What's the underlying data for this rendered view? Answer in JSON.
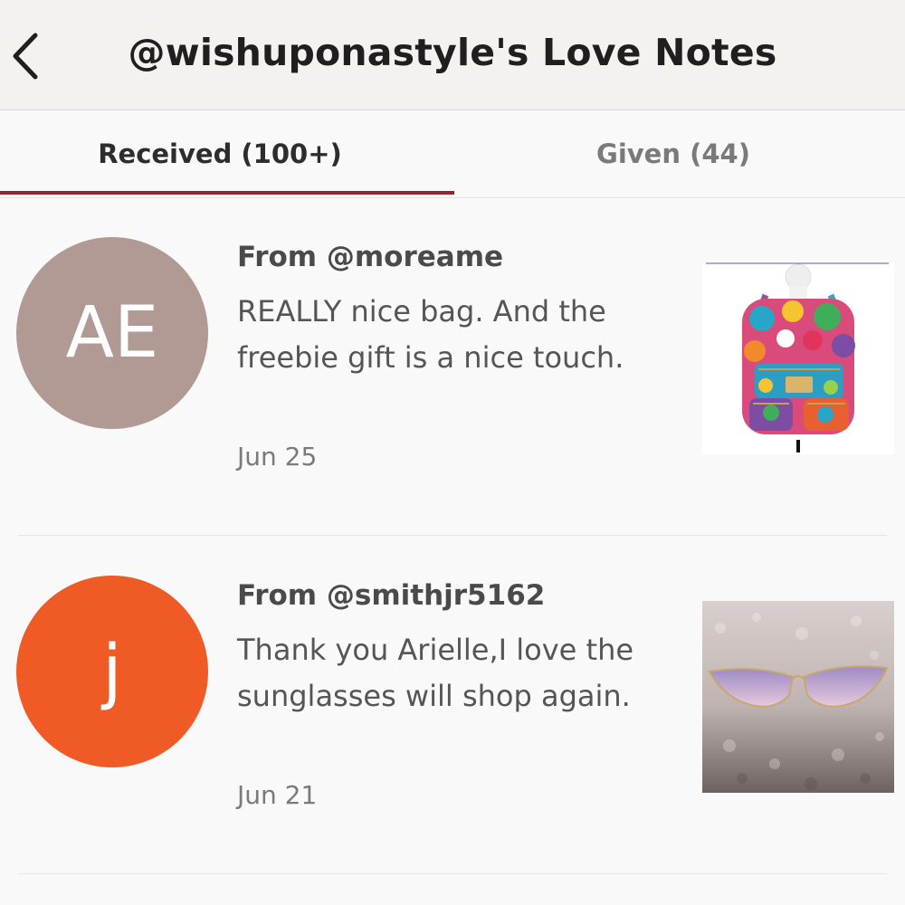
{
  "header": {
    "title": "@wishuponastyle's Love Notes",
    "back_icon": "chevron-left-icon"
  },
  "tabs": [
    {
      "label": "Received (100+)",
      "active": true
    },
    {
      "label": "Given (44)",
      "active": false
    }
  ],
  "colors": {
    "accent": "#8c2a32",
    "avatar_ae": "#b09a93",
    "avatar_j": "#f05a24"
  },
  "notes": [
    {
      "avatar_initials": "AE",
      "from": "From @moreame",
      "text": "REALLY nice bag. And the freebie gift is a nice touch.",
      "date": "Jun 25",
      "image": "colorful-backpack-photo"
    },
    {
      "avatar_initials": "j",
      "from": "From @smithjr5162",
      "text": "Thank you Arielle,I love the sunglasses will shop again.",
      "date": "Jun 21",
      "image": "sunglasses-photo"
    }
  ]
}
